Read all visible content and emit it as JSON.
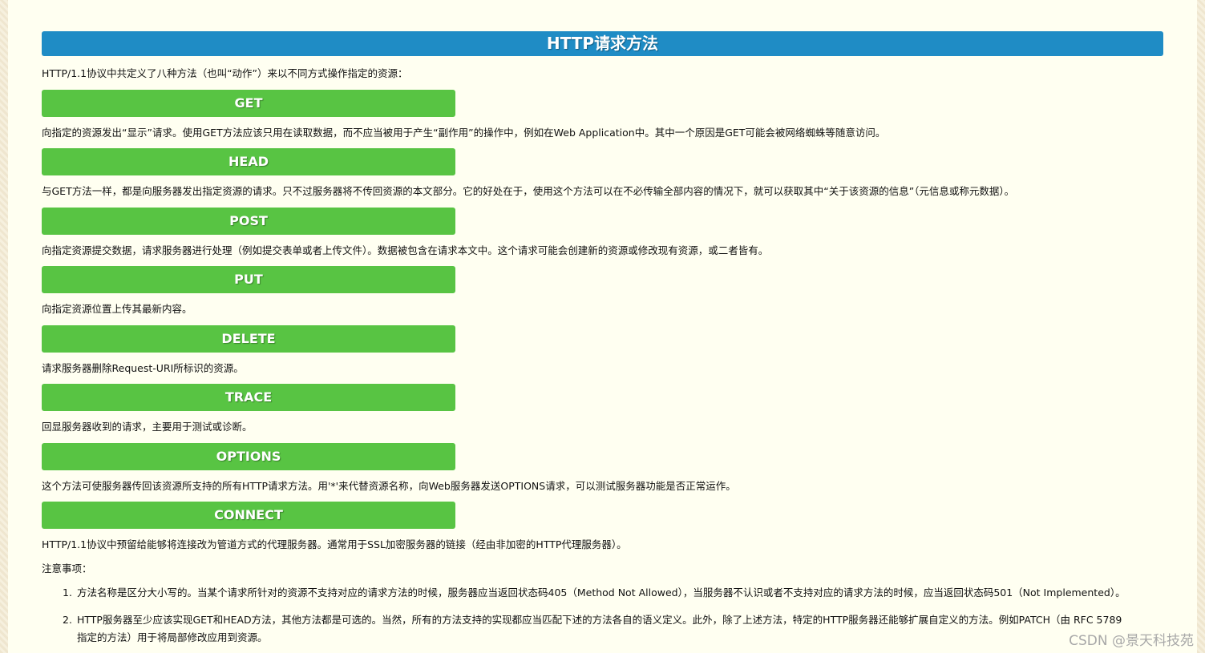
{
  "title": "HTTP请求方法",
  "intro": "HTTP/1.1协议中共定义了八种方法（也叫“动作”）来以不同方式操作指定的资源：",
  "methods": [
    {
      "name": "GET",
      "desc": "向指定的资源发出“显示”请求。使用GET方法应该只用在读取数据，而不应当被用于产生“副作用”的操作中，例如在Web Application中。其中一个原因是GET可能会被网络蜘蛛等随意访问。"
    },
    {
      "name": "HEAD",
      "desc": "与GET方法一样，都是向服务器发出指定资源的请求。只不过服务器将不传回资源的本文部分。它的好处在于，使用这个方法可以在不必传输全部内容的情况下，就可以获取其中“关于该资源的信息”（元信息或称元数据）。"
    },
    {
      "name": "POST",
      "desc": "向指定资源提交数据，请求服务器进行处理（例如提交表单或者上传文件）。数据被包含在请求本文中。这个请求可能会创建新的资源或修改现有资源，或二者皆有。"
    },
    {
      "name": "PUT",
      "desc": "向指定资源位置上传其最新内容。"
    },
    {
      "name": "DELETE",
      "desc": "请求服务器删除Request-URI所标识的资源。"
    },
    {
      "name": "TRACE",
      "desc": "回显服务器收到的请求，主要用于测试或诊断。"
    },
    {
      "name": "OPTIONS",
      "desc": "这个方法可使服务器传回该资源所支持的所有HTTP请求方法。用'*'来代替资源名称，向Web服务器发送OPTIONS请求，可以测试服务器功能是否正常运作。"
    },
    {
      "name": "CONNECT",
      "desc": "HTTP/1.1协议中预留给能够将连接改为管道方式的代理服务器。通常用于SSL加密服务器的链接（经由非加密的HTTP代理服务器）。"
    }
  ],
  "notes": {
    "heading": "注意事项：",
    "items": [
      {
        "num": "1.",
        "line1": "方法名称是区分大小写的。当某个请求所针对的资源不支持对应的请求方法的时候，服务器应当返回状态码405（Method Not Allowed），当服务器不认识或者不支持对应的请求方法的时候，应当返回状态码501（Not Implemented）。",
        "line2": ""
      },
      {
        "num": "2.",
        "line1": "HTTP服务器至少应该实现GET和HEAD方法，其他方法都是可选的。当然，所有的方法支持的实现都应当匹配下述的方法各自的语义定义。此外，除了上述方法，特定的HTTP服务器还能够扩展自定义的方法。例如PATCH（由 RFC 5789",
        "line2": "指定的方法）用于将局部修改应用到资源。"
      }
    ]
  },
  "watermark": "CSDN @景天科技苑",
  "colors": {
    "title_bar": "#1f8cc5",
    "method_bar": "#58c443",
    "page_bg": "#fffff1"
  }
}
